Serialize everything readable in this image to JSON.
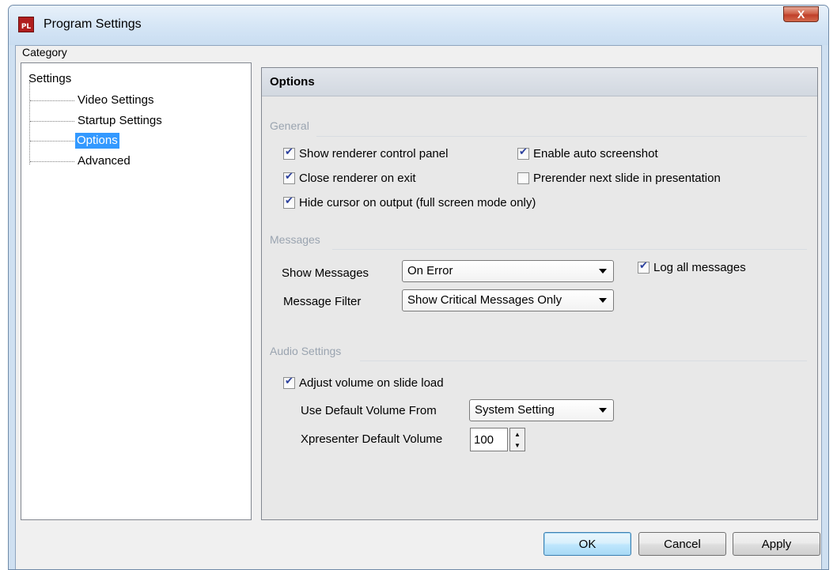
{
  "window": {
    "title": "Program Settings",
    "icon_text": "PL",
    "close_glyph": "X"
  },
  "sidebar": {
    "category_label": "Category",
    "root": "Settings",
    "items": [
      {
        "label": "Video Settings"
      },
      {
        "label": "Startup Settings"
      },
      {
        "label": "Options"
      },
      {
        "label": "Advanced"
      }
    ]
  },
  "panel": {
    "title": "Options",
    "general": {
      "heading": "General",
      "show_renderer": {
        "label": "Show renderer control panel",
        "checked": true
      },
      "enable_screenshot": {
        "label": "Enable auto screenshot",
        "checked": true
      },
      "close_renderer": {
        "label": "Close renderer on exit",
        "checked": true
      },
      "prerender": {
        "label": "Prerender next slide in presentation",
        "checked": false
      },
      "hide_cursor": {
        "label": "Hide cursor on output (full screen mode only)",
        "checked": true
      }
    },
    "messages": {
      "heading": "Messages",
      "show_messages_label": "Show Messages",
      "show_messages_value": "On Error",
      "message_filter_label": "Message Filter",
      "message_filter_value": "Show Critical Messages Only",
      "log_all": {
        "label": "Log all messages",
        "checked": true
      }
    },
    "audio": {
      "heading": "Audio Settings",
      "adjust_volume": {
        "label": "Adjust volume on slide load",
        "checked": true
      },
      "default_volume_from_label": "Use Default Volume From",
      "default_volume_from_value": "System Setting",
      "xpresenter_volume_label": "Xpresenter Default Volume",
      "xpresenter_volume_value": "100"
    }
  },
  "buttons": {
    "ok": "OK",
    "cancel": "Cancel",
    "apply": "Apply"
  },
  "colors": {
    "selection": "#3399ff",
    "section_heading": "#9aa4b0",
    "close_button": "#c0402a"
  }
}
